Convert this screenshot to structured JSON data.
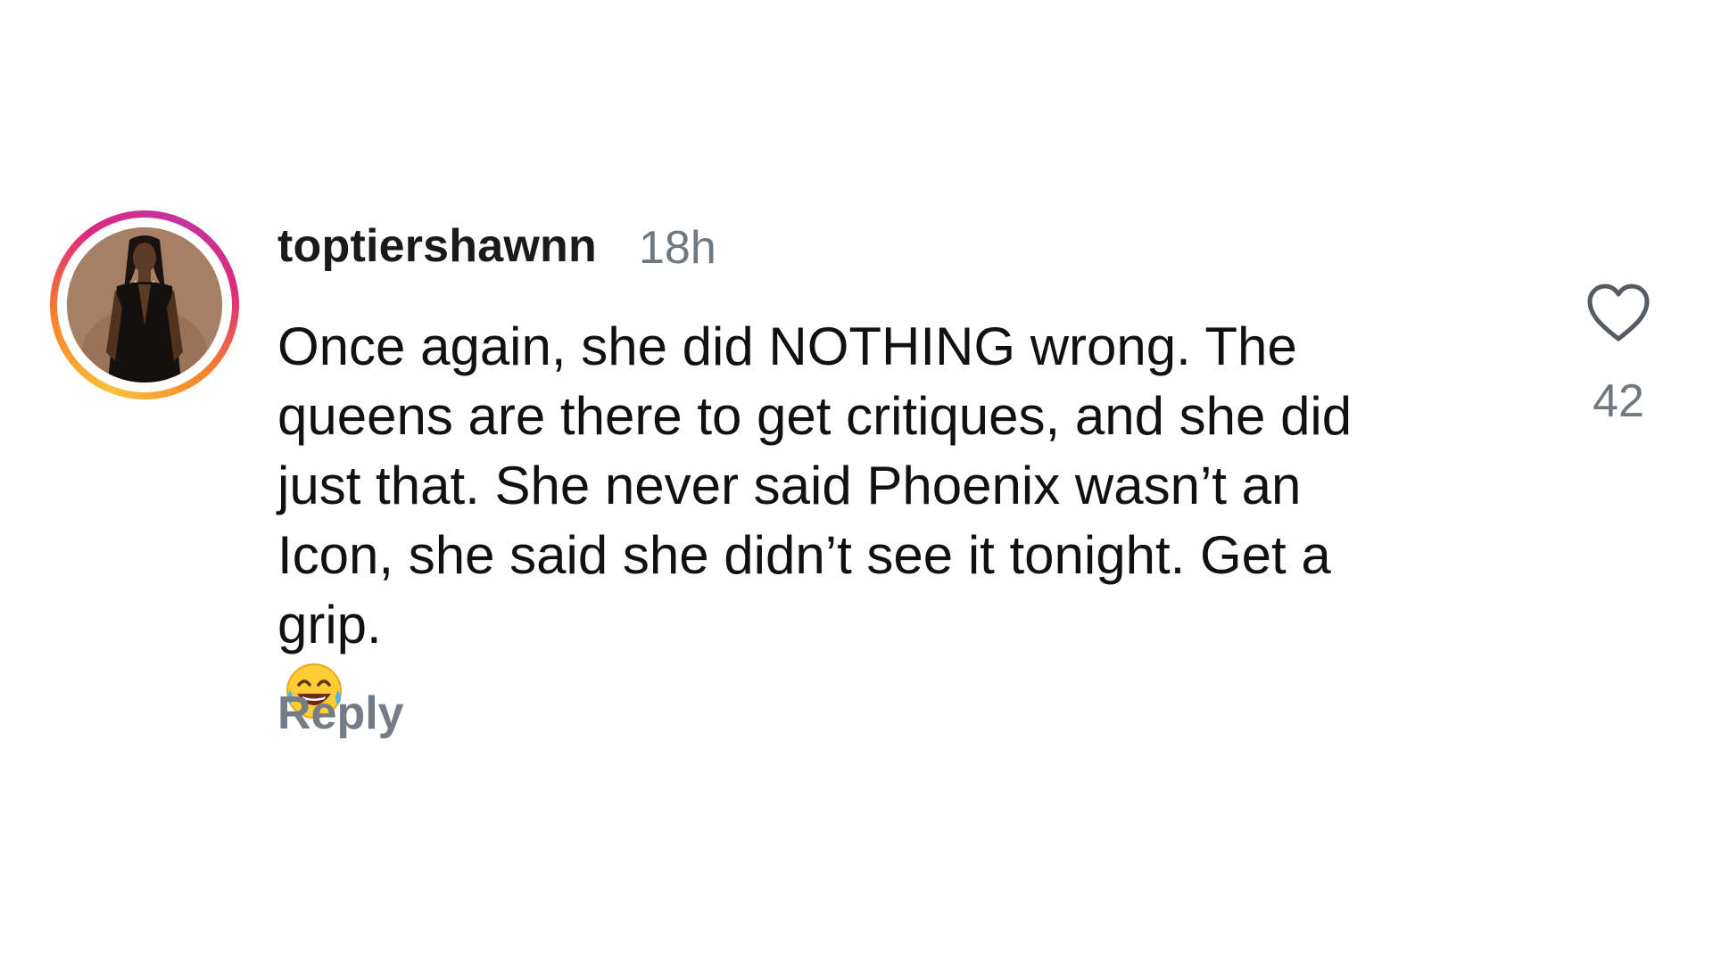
{
  "comment": {
    "username": "toptiershawnn",
    "time": "18h",
    "lines": [
      "Once again, she did NOTHING wrong. The",
      "queens are there to get critiques, and she did",
      "just that. She never said Phoenix wasn’t an",
      "Icon, she said she didn’t see it tonight. Get a",
      "grip."
    ],
    "trailing_emoji": "face-with-tears-of-joy-icon",
    "reply_label": "Reply",
    "like_icon": "heart-outline-icon",
    "like_count": "42"
  },
  "colors": {
    "ring_gradient": [
      "#f9c13a",
      "#f58529",
      "#dd2a7b",
      "#c1359f"
    ],
    "text": "#111111",
    "muted": "#6f7780",
    "background": "#ffffff"
  }
}
